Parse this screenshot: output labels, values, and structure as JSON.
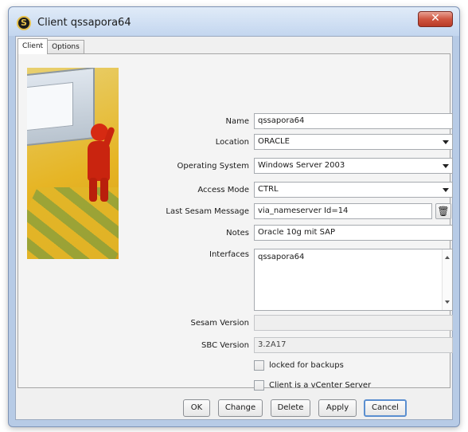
{
  "window": {
    "title": "Client qssapora64",
    "close_glyph": "✕"
  },
  "tabs": [
    {
      "label": "Client",
      "active": true
    },
    {
      "label": "Options",
      "active": false
    }
  ],
  "form": {
    "name": {
      "label": "Name",
      "value": "qssapora64"
    },
    "location": {
      "label": "Location",
      "value": "ORACLE"
    },
    "os": {
      "label": "Operating System",
      "value": "Windows Server 2003"
    },
    "access_mode": {
      "label": "Access Mode",
      "value": "CTRL"
    },
    "last_message": {
      "label": "Last Sesam Message",
      "value": "via_nameserver Id=14"
    },
    "notes": {
      "label": "Notes",
      "value": "Oracle 10g mit SAP"
    },
    "interfaces": {
      "label": "Interfaces",
      "value": "qssapora64"
    },
    "sesam_version": {
      "label": "Sesam Version",
      "value": ""
    },
    "sbc_version": {
      "label": "SBC Version",
      "value": "3.2A17"
    },
    "locked": {
      "label": "locked for backups",
      "checked": false
    },
    "vcenter": {
      "label": "Client is a vCenter Server",
      "checked": false
    }
  },
  "buttons": {
    "ok": "OK",
    "change": "Change",
    "delete": "Delete",
    "apply": "Apply",
    "cancel": "Cancel"
  },
  "icons": {
    "app": "sesam-logo-icon",
    "trash": "trash-icon"
  },
  "colors": {
    "close_button": "#cf5540",
    "default_button_border": "#5b8fd0",
    "side_image": "#e6b525"
  }
}
